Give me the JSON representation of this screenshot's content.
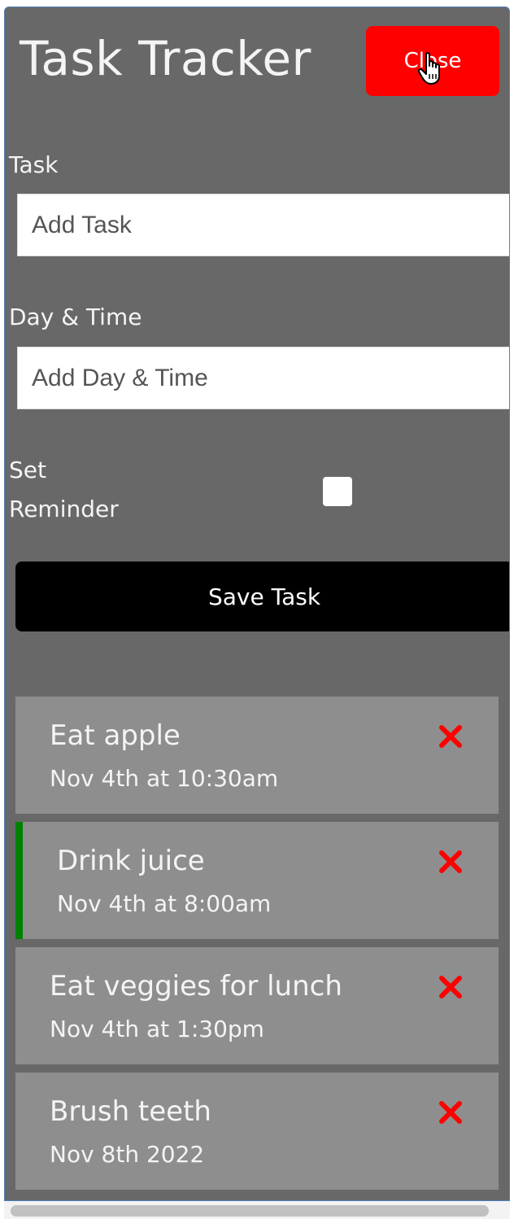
{
  "header": {
    "title": "Task Tracker",
    "close_label": "Close",
    "close_color": "#ff0000"
  },
  "form": {
    "task_label": "Task",
    "task_placeholder": "Add Task",
    "task_value": "",
    "day_label": "Day & Time",
    "day_placeholder": "Add Day & Time",
    "day_value": "",
    "reminder_label_line1": "Set",
    "reminder_label_line2": "Reminder",
    "reminder_checked": false,
    "save_label": "Save Task"
  },
  "tasks": [
    {
      "text": "Eat apple",
      "day": "Nov 4th at 10:30am",
      "reminder": false
    },
    {
      "text": "Drink juice",
      "day": "Nov 4th at 8:00am",
      "reminder": true
    },
    {
      "text": "Eat veggies for lunch",
      "day": "Nov 4th at 1:30pm",
      "reminder": false
    },
    {
      "text": "Brush teeth",
      "day": "Nov 8th 2022",
      "reminder": false
    }
  ],
  "icons": {
    "delete": "close-x-icon",
    "cursor": "hand-pointer-icon"
  },
  "colors": {
    "background": "#686868",
    "task_bg": "#8e8e8e",
    "reminder_border": "#008000",
    "delete": "#ff0000",
    "save_bg": "#000000"
  }
}
